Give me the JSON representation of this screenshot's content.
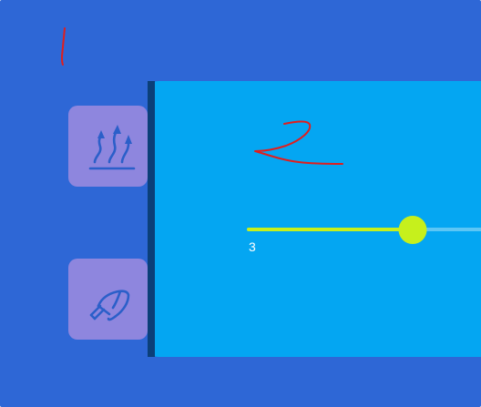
{
  "colors": {
    "background": "#2e67d6",
    "tile": "#8e86de",
    "tile_icon": "#2b5fc9",
    "panel": "#04a6f2",
    "panel_edge": "#0b3f79",
    "slider_fill": "#c6f01c",
    "slider_track": "#5cc6f5",
    "annotation": "#e01e1e"
  },
  "sidebar": {
    "items": [
      {
        "icon": "upward-arrows-icon"
      },
      {
        "icon": "spray-nozzle-icon"
      }
    ]
  },
  "panel": {
    "slider": {
      "value": "3",
      "fraction": 0.7
    }
  },
  "annotations": [
    {
      "text": "1"
    },
    {
      "text": "2"
    }
  ]
}
